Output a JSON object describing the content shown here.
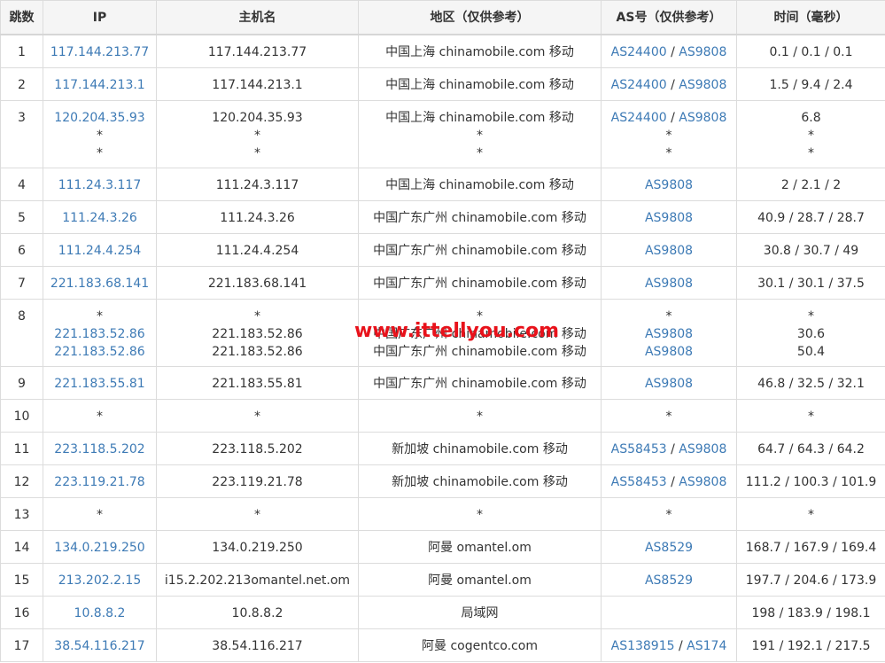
{
  "headers": [
    "跳数",
    "IP",
    "主机名",
    "地区（仅供参考）",
    "AS号（仅供参考）",
    "时间（毫秒）"
  ],
  "watermark": "www.ittellyou.com",
  "rows": [
    {
      "hop": "1",
      "ip": [
        "117.144.213.77"
      ],
      "host": [
        "117.144.213.77"
      ],
      "region": [
        "中国上海 chinamobile.com 移动"
      ],
      "as": [
        [
          "AS24400",
          "AS9808"
        ]
      ],
      "time": [
        "0.1 / 0.1 / 0.1"
      ]
    },
    {
      "hop": "2",
      "ip": [
        "117.144.213.1"
      ],
      "host": [
        "117.144.213.1"
      ],
      "region": [
        "中国上海 chinamobile.com 移动"
      ],
      "as": [
        [
          "AS24400",
          "AS9808"
        ]
      ],
      "time": [
        "1.5 / 9.4 / 2.4"
      ]
    },
    {
      "hop": "3",
      "ip": [
        "120.204.35.93",
        "*",
        "*"
      ],
      "host": [
        "120.204.35.93",
        "*",
        "*"
      ],
      "region": [
        "中国上海 chinamobile.com 移动",
        "*",
        "*"
      ],
      "as": [
        [
          "AS24400",
          "AS9808"
        ],
        [
          "*"
        ],
        [
          "*"
        ]
      ],
      "time": [
        "6.8",
        "*",
        "*"
      ]
    },
    {
      "hop": "4",
      "ip": [
        "111.24.3.117"
      ],
      "host": [
        "111.24.3.117"
      ],
      "region": [
        "中国上海 chinamobile.com 移动"
      ],
      "as": [
        [
          "AS9808"
        ]
      ],
      "time": [
        "2 / 2.1 / 2"
      ]
    },
    {
      "hop": "5",
      "ip": [
        "111.24.3.26"
      ],
      "host": [
        "111.24.3.26"
      ],
      "region": [
        "中国广东广州 chinamobile.com 移动"
      ],
      "as": [
        [
          "AS9808"
        ]
      ],
      "time": [
        "40.9 / 28.7 / 28.7"
      ]
    },
    {
      "hop": "6",
      "ip": [
        "111.24.4.254"
      ],
      "host": [
        "111.24.4.254"
      ],
      "region": [
        "中国广东广州 chinamobile.com 移动"
      ],
      "as": [
        [
          "AS9808"
        ]
      ],
      "time": [
        "30.8 / 30.7 / 49"
      ]
    },
    {
      "hop": "7",
      "ip": [
        "221.183.68.141"
      ],
      "host": [
        "221.183.68.141"
      ],
      "region": [
        "中国广东广州 chinamobile.com 移动"
      ],
      "as": [
        [
          "AS9808"
        ]
      ],
      "time": [
        "30.1 / 30.1 / 37.5"
      ]
    },
    {
      "hop": "8",
      "ip": [
        "*",
        "221.183.52.86",
        "221.183.52.86"
      ],
      "host": [
        "*",
        "221.183.52.86",
        "221.183.52.86"
      ],
      "region": [
        "*",
        "中国广东广州 chinamobile.com 移动",
        "中国广东广州 chinamobile.com 移动"
      ],
      "as": [
        [
          "*"
        ],
        [
          "AS9808"
        ],
        [
          "AS9808"
        ]
      ],
      "time": [
        "*",
        "30.6",
        "50.4"
      ]
    },
    {
      "hop": "9",
      "ip": [
        "221.183.55.81"
      ],
      "host": [
        "221.183.55.81"
      ],
      "region": [
        "中国广东广州 chinamobile.com 移动"
      ],
      "as": [
        [
          "AS9808"
        ]
      ],
      "time": [
        "46.8 / 32.5 / 32.1"
      ]
    },
    {
      "hop": "10",
      "ip": [
        "*"
      ],
      "host": [
        "*"
      ],
      "region": [
        "*"
      ],
      "as": [
        [
          "*"
        ]
      ],
      "time": [
        "*"
      ]
    },
    {
      "hop": "11",
      "ip": [
        "223.118.5.202"
      ],
      "host": [
        "223.118.5.202"
      ],
      "region": [
        "新加坡 chinamobile.com 移动"
      ],
      "as": [
        [
          "AS58453",
          "AS9808"
        ]
      ],
      "time": [
        "64.7 / 64.3 / 64.2"
      ]
    },
    {
      "hop": "12",
      "ip": [
        "223.119.21.78"
      ],
      "host": [
        "223.119.21.78"
      ],
      "region": [
        "新加坡 chinamobile.com 移动"
      ],
      "as": [
        [
          "AS58453",
          "AS9808"
        ]
      ],
      "time": [
        "111.2 / 100.3 / 101.9"
      ]
    },
    {
      "hop": "13",
      "ip": [
        "*"
      ],
      "host": [
        "*"
      ],
      "region": [
        "*"
      ],
      "as": [
        [
          "*"
        ]
      ],
      "time": [
        "*"
      ]
    },
    {
      "hop": "14",
      "ip": [
        "134.0.219.250"
      ],
      "host": [
        "134.0.219.250"
      ],
      "region": [
        "阿曼 omantel.om"
      ],
      "as": [
        [
          "AS8529"
        ]
      ],
      "time": [
        "168.7 / 167.9 / 169.4"
      ]
    },
    {
      "hop": "15",
      "ip": [
        "213.202.2.15"
      ],
      "host": [
        "i15.2.202.213omantel.net.om"
      ],
      "region": [
        "阿曼 omantel.om"
      ],
      "as": [
        [
          "AS8529"
        ]
      ],
      "time": [
        "197.7 / 204.6 / 173.9"
      ]
    },
    {
      "hop": "16",
      "ip": [
        "10.8.8.2"
      ],
      "host": [
        "10.8.8.2"
      ],
      "region": [
        "局域网"
      ],
      "as": [
        []
      ],
      "time": [
        "198 / 183.9 / 198.1"
      ]
    },
    {
      "hop": "17",
      "ip": [
        "38.54.116.217"
      ],
      "host": [
        "38.54.116.217"
      ],
      "region": [
        "阿曼 cogentco.com"
      ],
      "as": [
        [
          "AS138915",
          "AS174"
        ]
      ],
      "time": [
        "191 / 192.1 / 217.5"
      ]
    }
  ]
}
